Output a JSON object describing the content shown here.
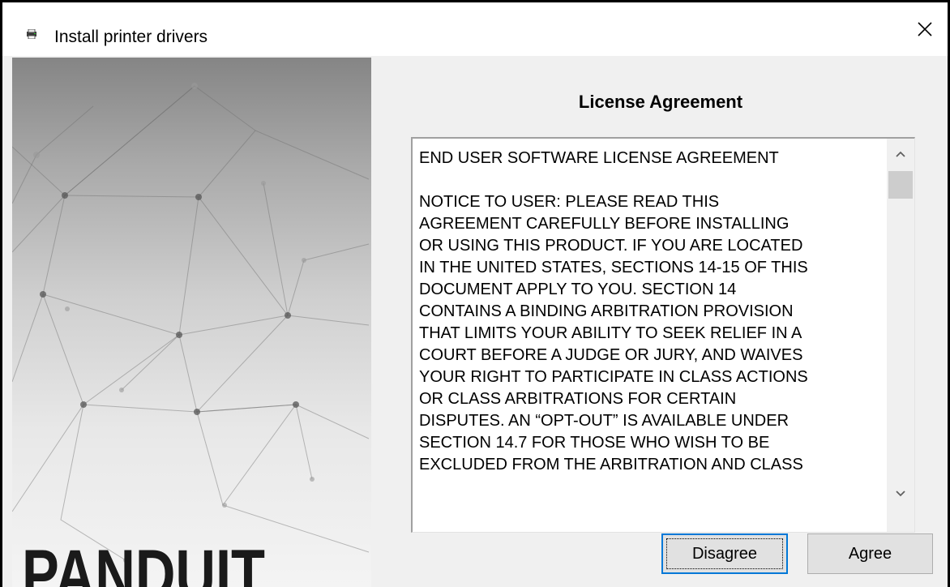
{
  "window": {
    "title": "Install printer drivers",
    "title_icon": "printer-icon",
    "close_icon": "close-icon"
  },
  "brand": {
    "logo_text": "PANDUIT"
  },
  "main": {
    "heading": "License Agreement",
    "license_lines": [
      "END USER SOFTWARE LICENSE AGREEMENT",
      "",
      "NOTICE TO USER: PLEASE READ THIS",
      "AGREEMENT CAREFULLY BEFORE INSTALLING",
      "OR USING THIS PRODUCT. IF YOU ARE LOCATED",
      "IN THE UNITED STATES, SECTIONS 14-15 OF THIS",
      "DOCUMENT APPLY TO YOU. SECTION 14",
      "CONTAINS A BINDING ARBITRATION PROVISION",
      "THAT LIMITS YOUR ABILITY TO SEEK RELIEF IN A",
      "COURT BEFORE A JUDGE OR JURY, AND WAIVES",
      "YOUR RIGHT TO PARTICIPATE IN CLASS ACTIONS",
      "OR CLASS ARBITRATIONS FOR CERTAIN",
      "DISPUTES. AN “OPT-OUT” IS AVAILABLE UNDER",
      "SECTION 14.7 FOR THOSE WHO WISH TO BE",
      "EXCLUDED FROM THE ARBITRATION AND CLASS"
    ],
    "scroll_position": 0.0
  },
  "buttons": {
    "disagree": "Disagree",
    "agree": "Agree"
  }
}
